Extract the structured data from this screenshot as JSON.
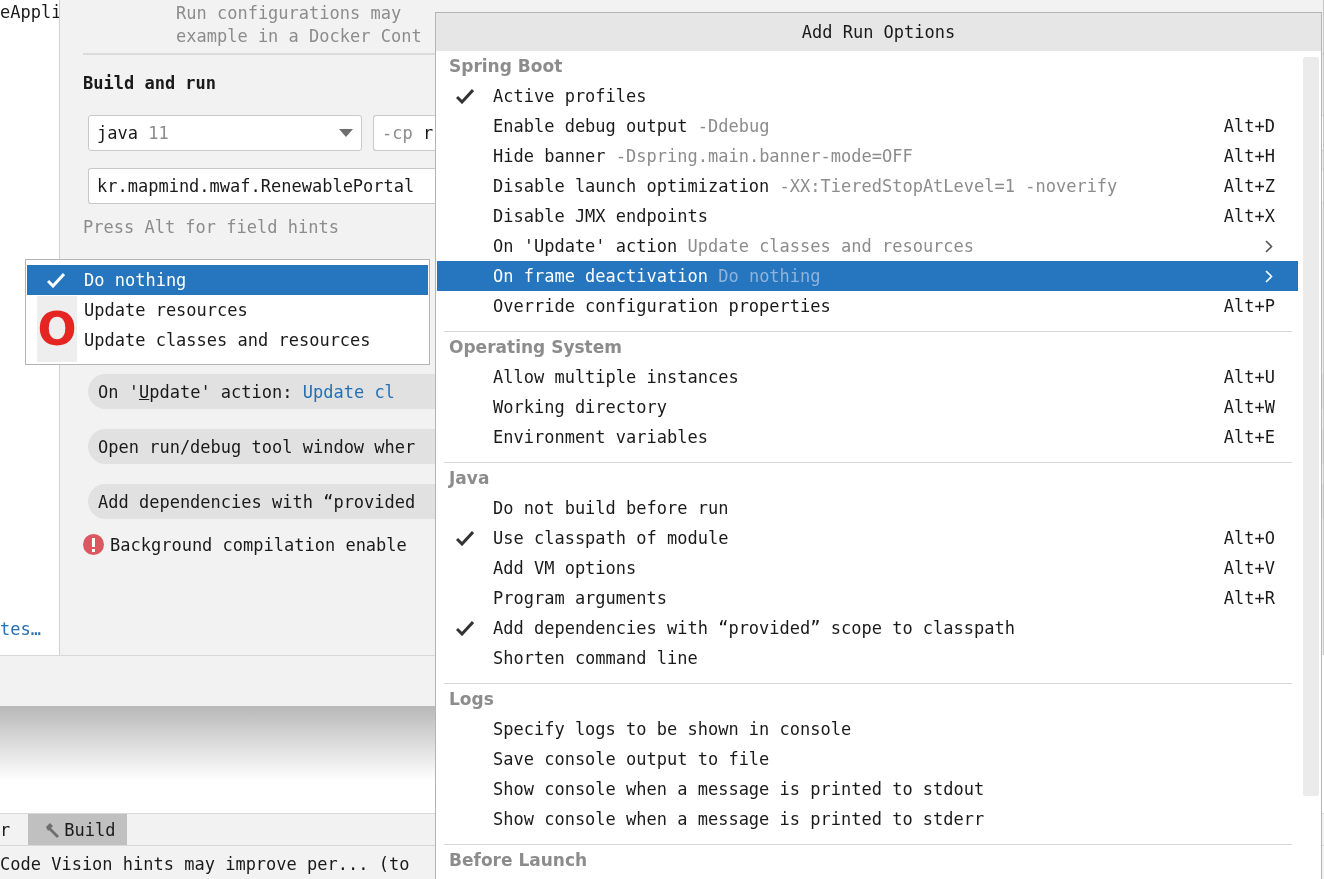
{
  "editor_fragment": {
    "text": "eAppli",
    "link": "tes…"
  },
  "dialog": {
    "description": [
      "Run configurations may",
      "example in a Docker Cont"
    ],
    "section_title": "Build and run",
    "jre_dropdown": {
      "value": "java",
      "version": "11"
    },
    "classpath_field": {
      "prefix": "-cp",
      "value": "r"
    },
    "main_class_field": {
      "value": "kr.mapmind.mwaf.RenewablePortal"
    },
    "hint": "Press Alt for field hints",
    "options": [
      {
        "kind": "choice",
        "label_before": "On '",
        "mnemonic": "U",
        "label_after": "pdate' action:",
        "value": "Update cl"
      },
      {
        "kind": "plain",
        "label": "Open run/debug tool window wher"
      },
      {
        "kind": "plain",
        "label": "Add dependencies with “provided"
      }
    ],
    "error": "Background compilation enable"
  },
  "update_dropdown": {
    "items": [
      {
        "label": "Do nothing",
        "selected": true
      },
      {
        "label": "Update resources",
        "selected": false
      },
      {
        "label": "Update classes and resources",
        "selected": false
      }
    ],
    "annotation": "O"
  },
  "tool_window_bar": {
    "tabs": [
      {
        "label": "r",
        "selected": false
      },
      {
        "label": "Build",
        "selected": true
      }
    ]
  },
  "status_bar": "Code Vision hints may improve per... (to",
  "popup": {
    "title": "Add Run Options",
    "sections": [
      {
        "title": "Spring Boot",
        "items": [
          {
            "label": "Active profiles",
            "checked": true,
            "selected": false
          },
          {
            "label": "Enable debug output",
            "hint": "-Ddebug",
            "shortcut": "Alt+D",
            "checked": false,
            "selected": false
          },
          {
            "label": "Hide banner",
            "hint": "-Dspring.main.banner-mode=OFF",
            "shortcut": "Alt+H",
            "checked": false,
            "selected": false
          },
          {
            "label": "Disable launch optimization",
            "hint": "-XX:TieredStopAtLevel=1 -noverify",
            "shortcut": "Alt+Z",
            "checked": false,
            "selected": false
          },
          {
            "label": "Disable JMX endpoints",
            "shortcut": "Alt+X",
            "checked": false,
            "selected": false
          },
          {
            "label": "On 'Update' action",
            "hint": "Update classes and resources",
            "submenu": true,
            "checked": false,
            "selected": false
          },
          {
            "label": "On frame deactivation",
            "hint": "Do nothing",
            "submenu": true,
            "checked": false,
            "selected": true
          },
          {
            "label": "Override configuration properties",
            "shortcut": "Alt+P",
            "checked": false,
            "selected": false
          }
        ]
      },
      {
        "title": "Operating System",
        "items": [
          {
            "label": "Allow multiple instances",
            "shortcut": "Alt+U",
            "checked": false,
            "selected": false
          },
          {
            "label": "Working directory",
            "shortcut": "Alt+W",
            "checked": false,
            "selected": false
          },
          {
            "label": "Environment variables",
            "shortcut": "Alt+E",
            "checked": false,
            "selected": false
          }
        ]
      },
      {
        "title": "Java",
        "items": [
          {
            "label": "Do not build before run",
            "checked": false,
            "selected": false
          },
          {
            "label": "Use classpath of module",
            "shortcut": "Alt+O",
            "checked": true,
            "selected": false
          },
          {
            "label": "Add VM options",
            "shortcut": "Alt+V",
            "checked": false,
            "selected": false
          },
          {
            "label": "Program arguments",
            "shortcut": "Alt+R",
            "checked": false,
            "selected": false
          },
          {
            "label": "Add dependencies with “provided” scope to classpath",
            "checked": true,
            "selected": false
          },
          {
            "label": "Shorten command line",
            "checked": false,
            "selected": false
          }
        ]
      },
      {
        "title": "Logs",
        "items": [
          {
            "label": "Specify logs to be shown in console",
            "checked": false,
            "selected": false
          },
          {
            "label": "Save console output to file",
            "checked": false,
            "selected": false
          },
          {
            "label": "Show console when a message is printed to stdout",
            "checked": false,
            "selected": false
          },
          {
            "label": "Show console when a message is printed to stderr",
            "checked": false,
            "selected": false
          }
        ]
      },
      {
        "title": "Before Launch"
      }
    ]
  }
}
